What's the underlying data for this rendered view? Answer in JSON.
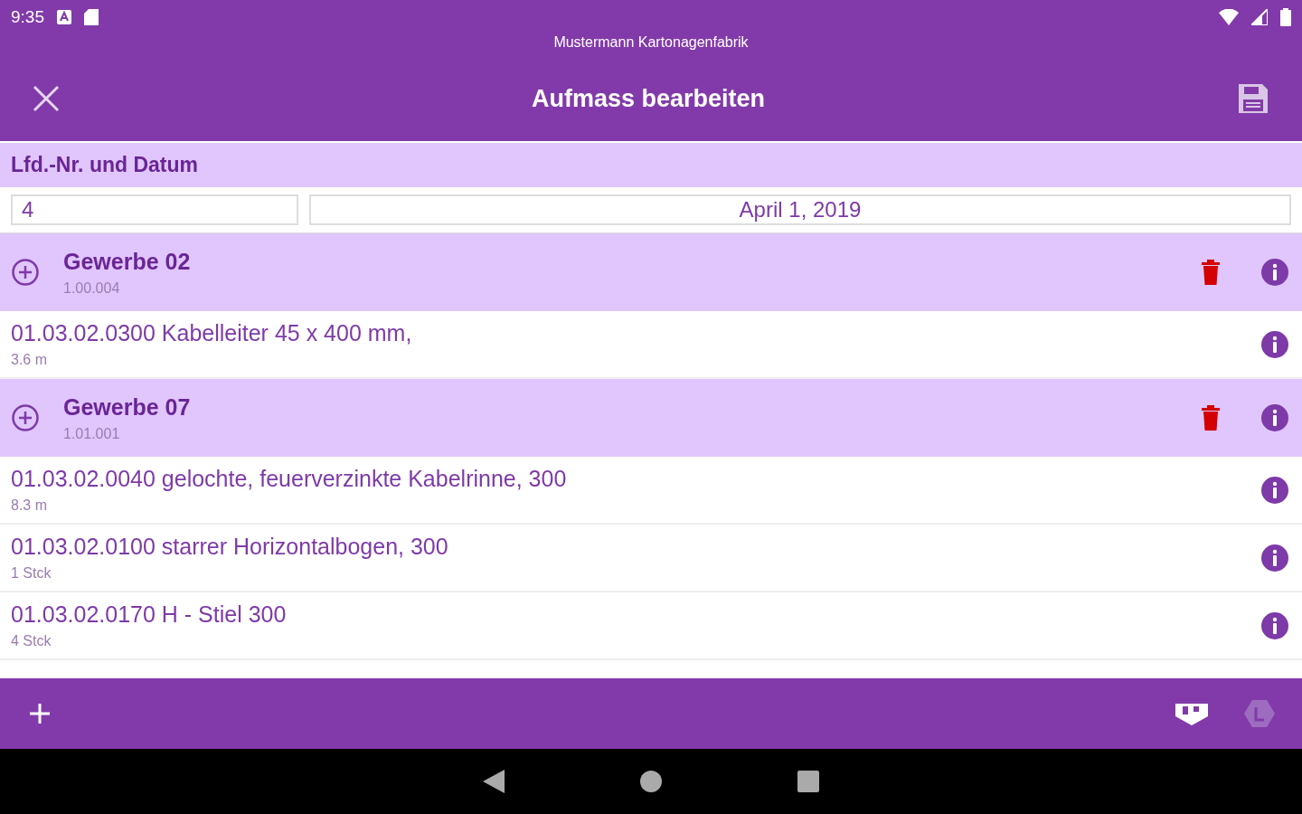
{
  "status_bar": {
    "time": "9:35"
  },
  "app_bar": {
    "company": "Mustermann Kartonagenfabrik",
    "title": "Aufmass bearbeiten"
  },
  "section": {
    "title": "Lfd.-Nr. und Datum"
  },
  "number_field": {
    "value": "4"
  },
  "date_field": {
    "value": "April 1, 2019"
  },
  "rows": [
    {
      "kind": "group",
      "title": "Gewerbe 02",
      "subtitle": "1.00.004"
    },
    {
      "kind": "item",
      "title": "01.03.02.0300 Kabelleiter 45 x 400 mm,",
      "subtitle": "3.6 m"
    },
    {
      "kind": "group",
      "title": "Gewerbe 07",
      "subtitle": "1.01.001"
    },
    {
      "kind": "item",
      "title": "01.03.02.0040 gelochte, feuerverzinkte Kabelrinne, 300",
      "subtitle": "8.3 m"
    },
    {
      "kind": "item",
      "title": "01.03.02.0100 starrer Horizontalbogen, 300",
      "subtitle": "1 Stck"
    },
    {
      "kind": "item",
      "title": "01.03.02.0170 H - Stiel 300",
      "subtitle": "4 Stck"
    }
  ]
}
